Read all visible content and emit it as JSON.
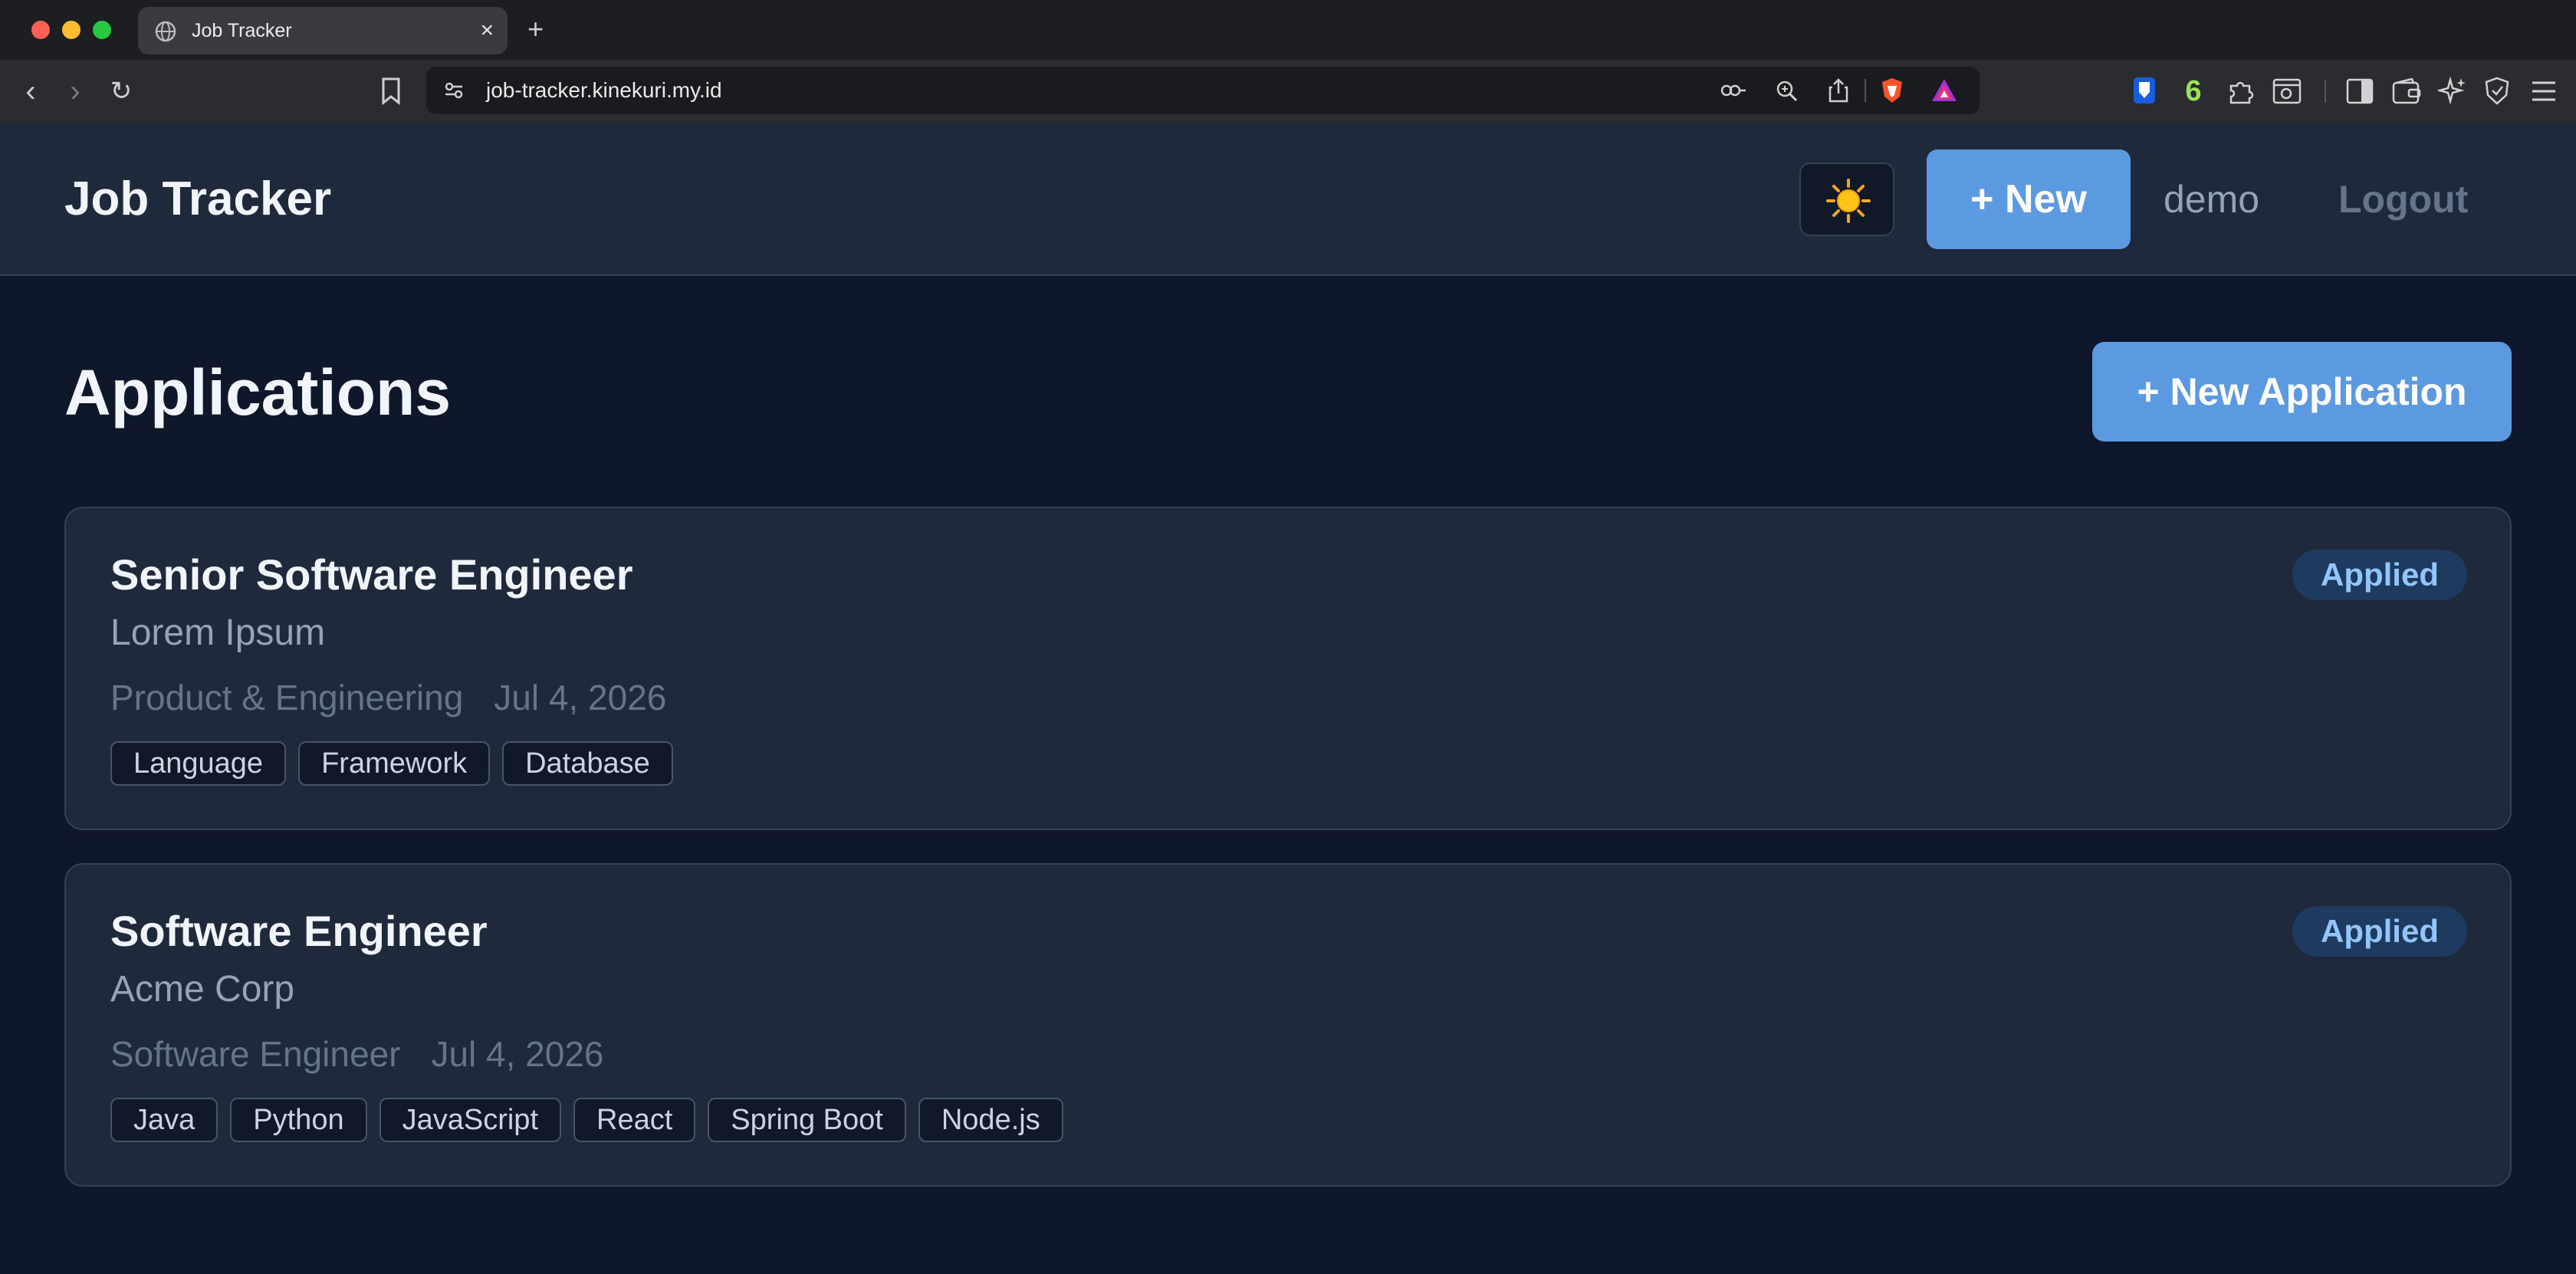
{
  "browser": {
    "tab_title": "Job Tracker",
    "tab_close": "×",
    "new_tab": "+",
    "url": "job-tracker.kinekuri.my.id",
    "icons": {
      "back": "‹",
      "forward": "›",
      "reload": "↻",
      "badge_count": "6"
    }
  },
  "header": {
    "brand": "Job Tracker",
    "theme_icon": "sun-icon",
    "new_label": "+ New",
    "user": "demo",
    "logout_label": "Logout"
  },
  "main": {
    "title": "Applications",
    "new_application_label": "+ New Application",
    "applications": [
      {
        "title": "Senior Software Engineer",
        "company": "Lorem Ipsum",
        "department": "Product & Engineering",
        "date": "Jul 4, 2026",
        "status": "Applied",
        "tags": [
          "Language",
          "Framework",
          "Database"
        ]
      },
      {
        "title": "Software Engineer",
        "company": "Acme Corp",
        "department": "Software Engineer",
        "date": "Jul 4, 2026",
        "status": "Applied",
        "tags": [
          "Java",
          "Python",
          "JavaScript",
          "React",
          "Spring Boot",
          "Node.js"
        ]
      }
    ]
  },
  "colors": {
    "accent": "#5b9ae0",
    "background": "#0f172a",
    "surface": "#1e293b",
    "status_badge_bg": "#1e3a5f",
    "status_badge_text": "#93c5fd"
  }
}
